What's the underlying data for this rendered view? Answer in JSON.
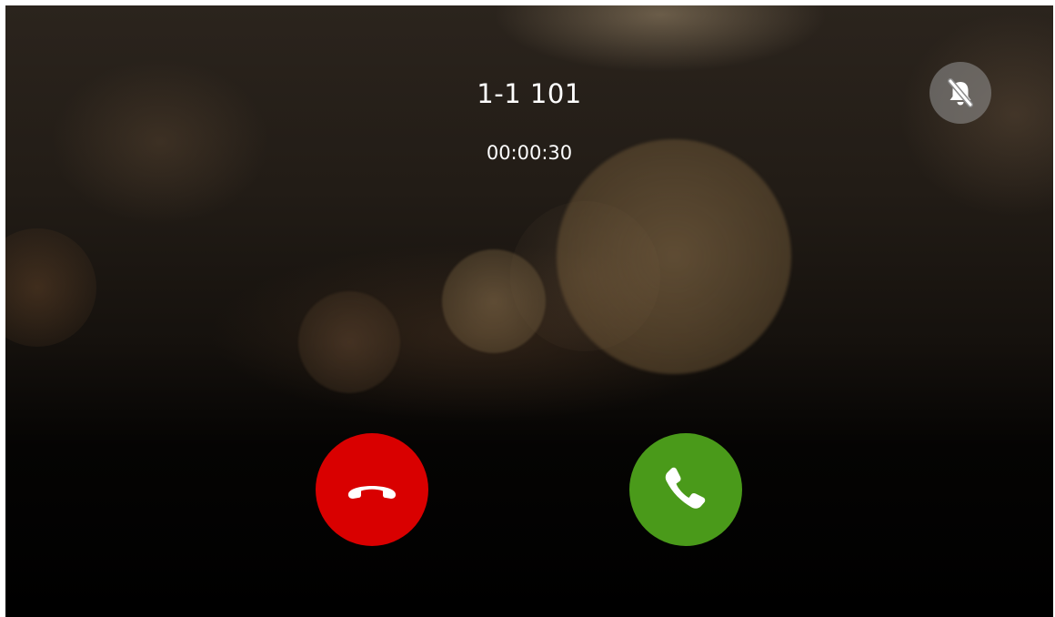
{
  "call": {
    "caller": "1-1 101",
    "timer": "00:00:30"
  },
  "controls": {
    "mute_icon": "bell-off-icon",
    "decline_icon": "hang-up-icon",
    "answer_icon": "phone-icon"
  },
  "colors": {
    "decline": "#d90000",
    "answer": "#4a9a1a",
    "mute_bg": "#8c8c8c"
  }
}
